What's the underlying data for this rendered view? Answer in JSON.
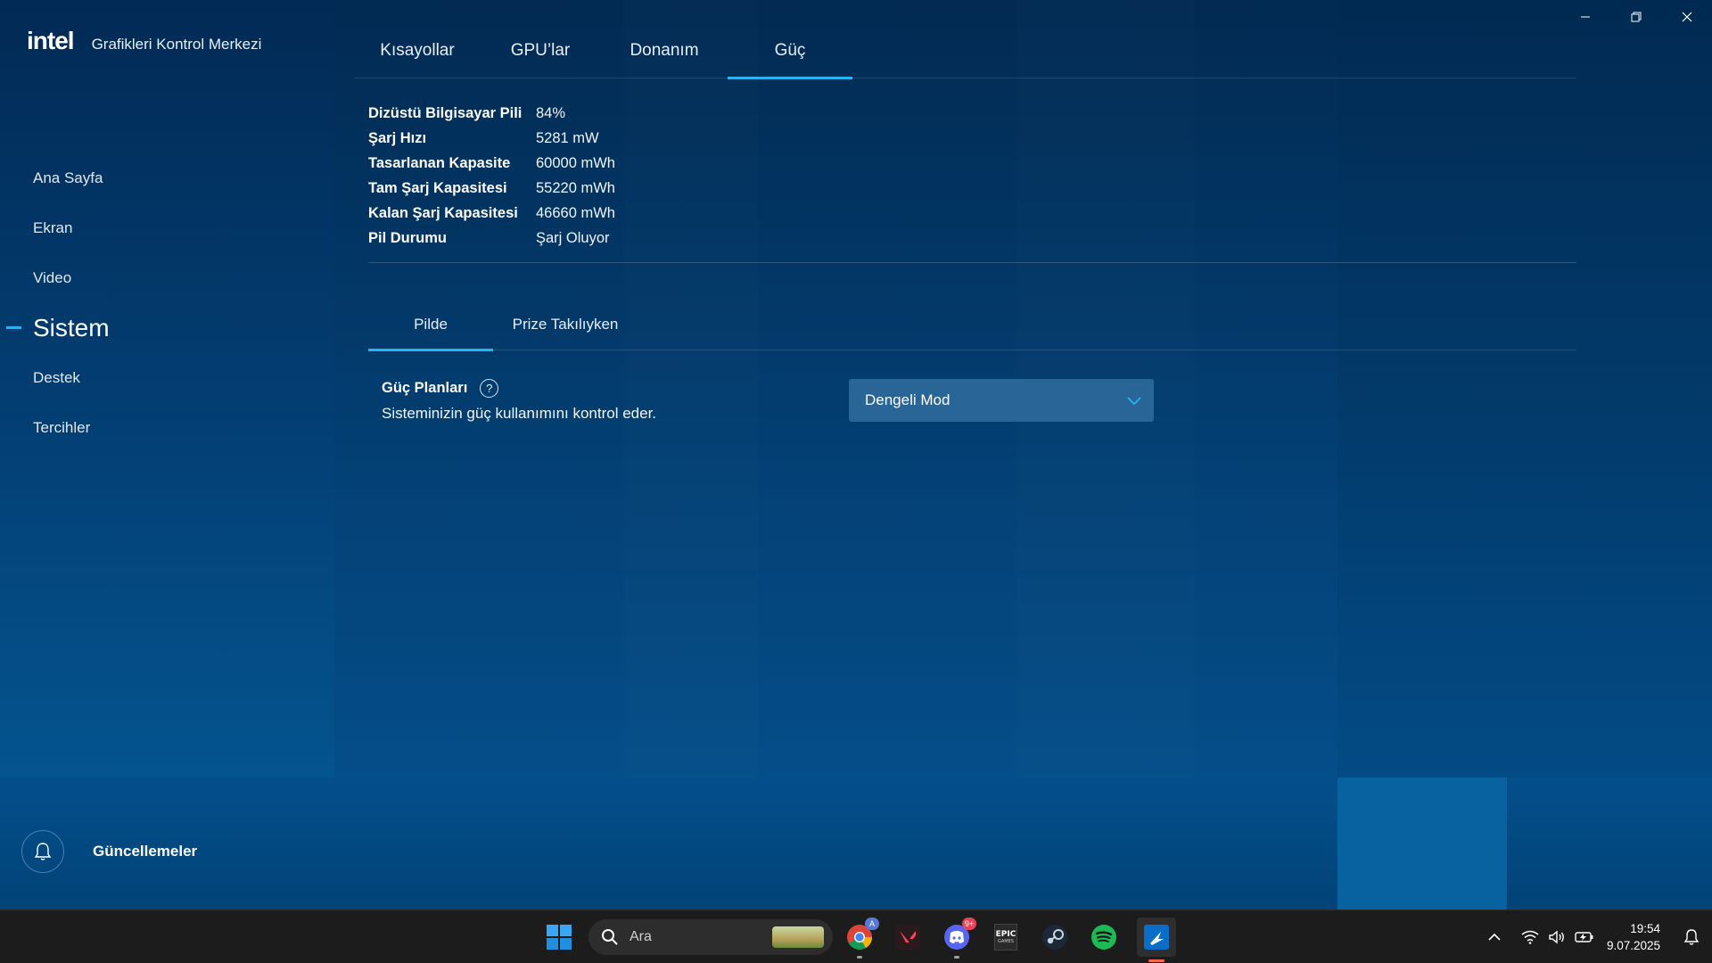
{
  "app": {
    "logo_text": "intel",
    "title": "Grafikleri Kontrol Merkezi"
  },
  "window_controls": [
    "minimize",
    "restore",
    "close"
  ],
  "sidebar": {
    "items": [
      {
        "label": "Ana Sayfa",
        "active": false
      },
      {
        "label": "Ekran",
        "active": false
      },
      {
        "label": "Video",
        "active": false
      },
      {
        "label": "Sistem",
        "active": true
      },
      {
        "label": "Destek",
        "active": false
      },
      {
        "label": "Tercihler",
        "active": false
      }
    ],
    "updates_label": "Güncellemeler"
  },
  "tabs": [
    {
      "label": "Kısayollar",
      "active": false
    },
    {
      "label": "GPU’lar",
      "active": false
    },
    {
      "label": "Donanım",
      "active": false
    },
    {
      "label": "Güç",
      "active": true
    }
  ],
  "battery": {
    "rows": [
      {
        "key": "Dizüstü Bilgisayar Pili",
        "value": "84%"
      },
      {
        "key": "Şarj Hızı",
        "value": "5281 mW"
      },
      {
        "key": "Tasarlanan Kapasite",
        "value": "60000 mWh"
      },
      {
        "key": "Tam Şarj Kapasitesi",
        "value": "55220 mWh"
      },
      {
        "key": "Kalan Şarj Kapasitesi",
        "value": "46660 mWh"
      },
      {
        "key": "Pil Durumu",
        "value": "Şarj Oluyor"
      }
    ]
  },
  "subtabs": [
    {
      "label": "Pilde",
      "active": true
    },
    {
      "label": "Prize Takılıyken",
      "active": false
    }
  ],
  "power_plan": {
    "title": "Güç Planları",
    "help": "?",
    "description": "Sisteminizin güç kullanımını kontrol eder.",
    "selected": "Dengeli Mod"
  },
  "taskbar": {
    "search_placeholder": "Ara",
    "chrome_badge": "A",
    "discord_badge": "9+",
    "epic_text": "EPIC",
    "epic_sub": "GAMES",
    "time": "19:54",
    "date": "9.07.2025"
  },
  "colors": {
    "accent": "#27b4f0",
    "select_bg": "#2a6597"
  }
}
